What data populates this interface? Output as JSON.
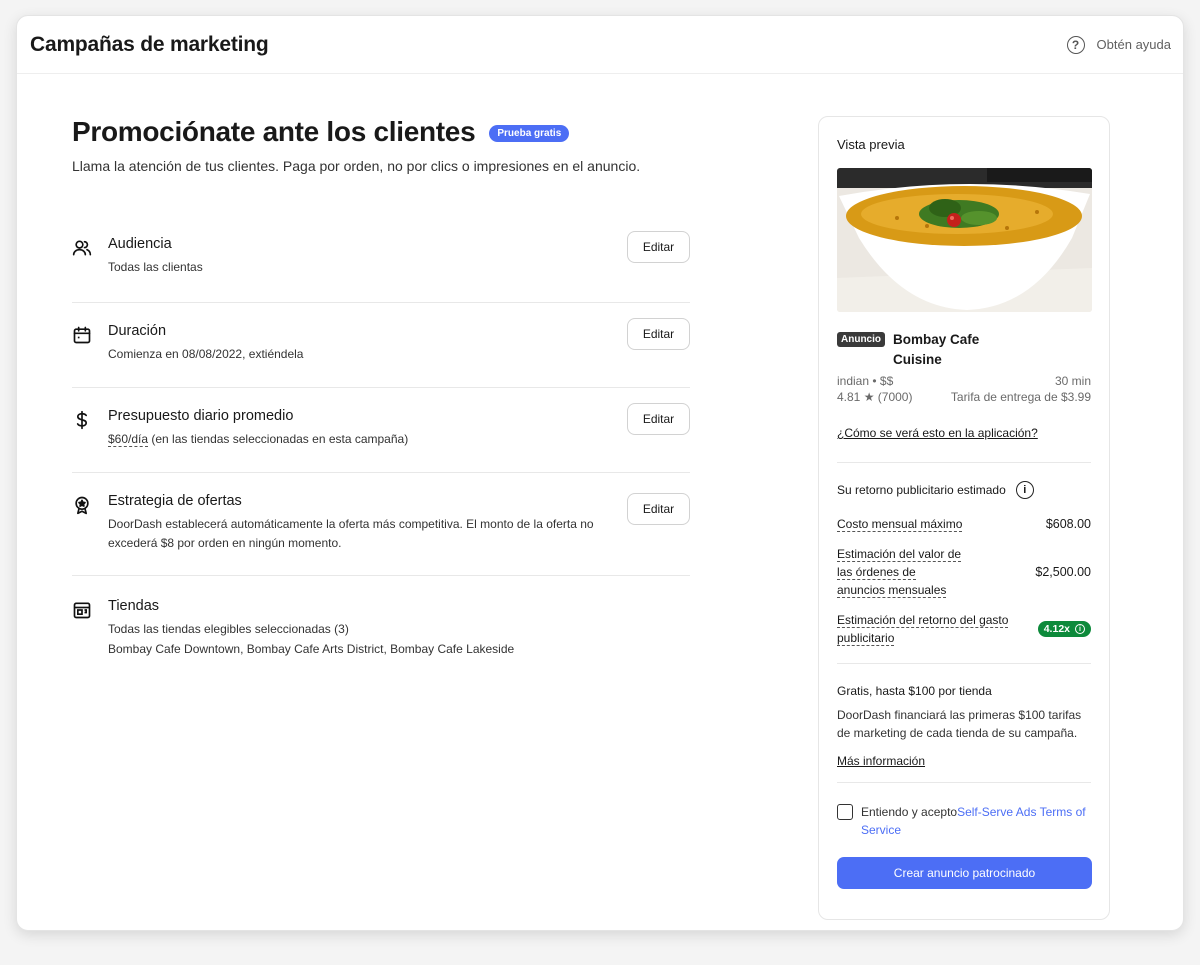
{
  "header": {
    "title": "Campañas de marketing",
    "help_label": "Obtén ayuda",
    "help_icon_glyph": "?"
  },
  "main": {
    "heading": "Promociónate ante los clientes",
    "badge": "Prueba gratis",
    "subtitle": "Llama la atención de tus clientes. Paga por orden, no por clics o impresiones en el anuncio.",
    "edit_label": "Editar",
    "sections": [
      {
        "icon": "audience-icon",
        "title": "Audiencia",
        "lines": [
          "Todas las clientas"
        ]
      },
      {
        "icon": "calendar-icon",
        "title": "Duración",
        "lines": [
          "Comienza en 08/08/2022, extiéndela"
        ]
      },
      {
        "icon": "dollar-icon",
        "title": "Presupuesto diario promedio",
        "budget": "$60/día",
        "budget_note": " (en las tiendas seleccionadas en esta campaña)"
      },
      {
        "icon": "offer-badge-icon",
        "title": "Estrategia de ofertas",
        "lines": [
          "DoorDash establecerá automáticamente la oferta más competitiva. El monto de la oferta no excederá $8 por orden en ningún momento."
        ]
      },
      {
        "icon": "store-icon",
        "title": "Tiendas",
        "lines": [
          "Todas las tiendas elegibles seleccionadas (3)",
          "Bombay Cafe Downtown, Bombay Cafe Arts District, Bombay Cafe Lakeside"
        ]
      }
    ]
  },
  "preview": {
    "title": "Vista previa",
    "ad_tag": "Anuncio",
    "store_name": "Bombay Cafe Cuisine",
    "cuisine": "indian • $$",
    "eta": "30 min",
    "rating": "4.81 ★ (7000)",
    "delivery_fee": "Tarifa de entrega de $3.99",
    "how_link": "¿Cómo se verá esto en la aplicación?"
  },
  "roi": {
    "title": "Su retorno publicitario estimado",
    "info_glyph": "i",
    "rows": [
      {
        "label": "Costo mensual máximo",
        "value": "$608.00"
      },
      {
        "label": "Estimación del valor de las órdenes de anuncios mensuales",
        "value": "$2,500.00"
      },
      {
        "label": "Estimación del retorno del gasto publicitario",
        "value": "4.12x"
      }
    ]
  },
  "free": {
    "title": "Gratis, hasta $100 por tienda",
    "text": "DoorDash financiará las primeras $100 tarifas de marketing de cada tienda de su campaña.",
    "more_link": "Más información"
  },
  "terms": {
    "prefix": "Entiendo y acepto",
    "link": "Self-Serve Ads Terms of Service"
  },
  "cta_label": "Crear anuncio patrocinado",
  "colors": {
    "accent": "#4c6ef5",
    "roi_badge": "#0d8a3b"
  }
}
